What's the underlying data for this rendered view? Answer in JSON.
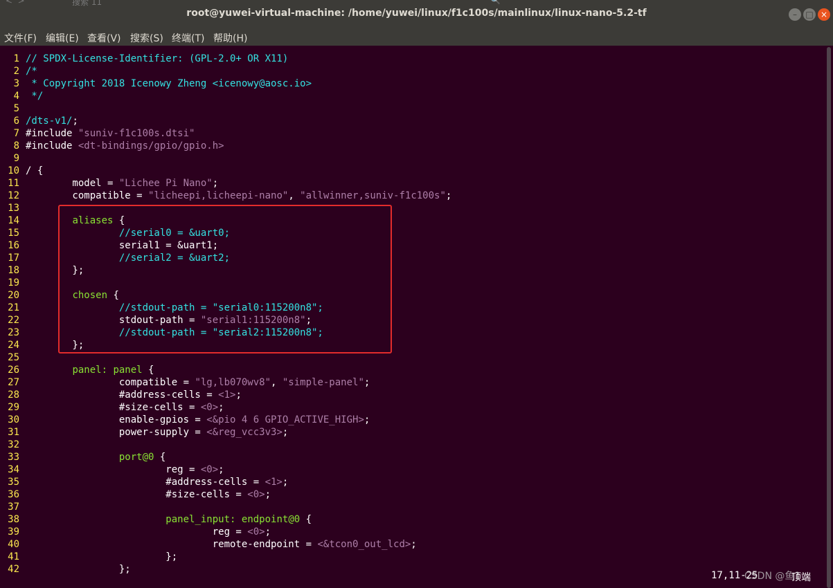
{
  "window": {
    "title": "root@yuwei-virtual-machine: /home/yuwei/linux/f1c100s/mainlinux/linux-nano-5.2-tf",
    "ghost_tab": "搜索 11",
    "controls": {
      "minimize": "–",
      "maximize": "□",
      "close": "×"
    }
  },
  "menu": [
    "文件(F)",
    "编辑(E)",
    "查看(V)",
    "搜索(S)",
    "终端(T)",
    "帮助(H)"
  ],
  "editor": {
    "lines": [
      {
        "n": "1",
        "segs": [
          {
            "t": "// SPDX-License-Identifier: (GPL-2.0+ OR X11)",
            "c": "comment"
          }
        ]
      },
      {
        "n": "2",
        "segs": [
          {
            "t": "/*",
            "c": "comment"
          }
        ]
      },
      {
        "n": "3",
        "segs": [
          {
            "t": " * Copyright 2018 Icenowy Zheng <icenowy@aosc.io>",
            "c": "comment"
          }
        ]
      },
      {
        "n": "4",
        "segs": [
          {
            "t": " */",
            "c": "comment"
          }
        ]
      },
      {
        "n": "5",
        "segs": []
      },
      {
        "n": "6",
        "segs": [
          {
            "t": "/dts-v1/",
            "c": "keyword"
          },
          {
            "t": ";",
            "c": "pp"
          }
        ]
      },
      {
        "n": "7",
        "segs": [
          {
            "t": "#include ",
            "c": "pp"
          },
          {
            "t": "\"suniv-f1c100s.dtsi\"",
            "c": "string"
          }
        ]
      },
      {
        "n": "8",
        "segs": [
          {
            "t": "#include ",
            "c": "pp"
          },
          {
            "t": "<dt-bindings/gpio/gpio.h>",
            "c": "string"
          }
        ]
      },
      {
        "n": "9",
        "segs": []
      },
      {
        "n": "10",
        "segs": [
          {
            "t": "/ {",
            "c": "pp"
          }
        ]
      },
      {
        "n": "11",
        "segs": [
          {
            "t": "        model = ",
            "c": "pp"
          },
          {
            "t": "\"Lichee Pi Nano\"",
            "c": "string"
          },
          {
            "t": ";",
            "c": "pp"
          }
        ]
      },
      {
        "n": "12",
        "segs": [
          {
            "t": "        compatible = ",
            "c": "pp"
          },
          {
            "t": "\"licheepi,licheepi-nano\"",
            "c": "string"
          },
          {
            "t": ", ",
            "c": "pp"
          },
          {
            "t": "\"allwinner,suniv-f1c100s\"",
            "c": "string"
          },
          {
            "t": ";",
            "c": "pp"
          }
        ]
      },
      {
        "n": "13",
        "segs": []
      },
      {
        "n": "14",
        "segs": [
          {
            "t": "        ",
            "c": "pp"
          },
          {
            "t": "aliases",
            "c": "label"
          },
          {
            "t": " {",
            "c": "pp"
          }
        ]
      },
      {
        "n": "15",
        "segs": [
          {
            "t": "                ",
            "c": "pp"
          },
          {
            "t": "//serial0 = &uart0;",
            "c": "comment"
          }
        ]
      },
      {
        "n": "16",
        "segs": [
          {
            "t": "                serial1 = &uart1;",
            "c": "pp"
          }
        ]
      },
      {
        "n": "17",
        "segs": [
          {
            "t": "                ",
            "c": "pp"
          },
          {
            "t": "//serial2 = &uart2;",
            "c": "comment"
          }
        ]
      },
      {
        "n": "18",
        "segs": [
          {
            "t": "        };",
            "c": "pp"
          }
        ]
      },
      {
        "n": "19",
        "segs": []
      },
      {
        "n": "20",
        "segs": [
          {
            "t": "        ",
            "c": "pp"
          },
          {
            "t": "chosen",
            "c": "label"
          },
          {
            "t": " {",
            "c": "pp"
          }
        ]
      },
      {
        "n": "21",
        "segs": [
          {
            "t": "                ",
            "c": "pp"
          },
          {
            "t": "//stdout-path = \"serial0:115200n8\";",
            "c": "comment"
          }
        ]
      },
      {
        "n": "22",
        "segs": [
          {
            "t": "                stdout-path = ",
            "c": "pp"
          },
          {
            "t": "\"serial1:115200n8\"",
            "c": "string"
          },
          {
            "t": ";",
            "c": "pp"
          }
        ]
      },
      {
        "n": "23",
        "segs": [
          {
            "t": "                ",
            "c": "pp"
          },
          {
            "t": "//stdout-path = \"serial2:115200n8\";",
            "c": "comment"
          }
        ]
      },
      {
        "n": "24",
        "segs": [
          {
            "t": "        };",
            "c": "pp"
          }
        ]
      },
      {
        "n": "25",
        "segs": []
      },
      {
        "n": "26",
        "segs": [
          {
            "t": "        ",
            "c": "pp"
          },
          {
            "t": "panel:",
            "c": "label"
          },
          {
            "t": " ",
            "c": "pp"
          },
          {
            "t": "panel",
            "c": "label"
          },
          {
            "t": " {",
            "c": "pp"
          }
        ]
      },
      {
        "n": "27",
        "segs": [
          {
            "t": "                compatible = ",
            "c": "pp"
          },
          {
            "t": "\"lg,lb070wv8\"",
            "c": "string"
          },
          {
            "t": ", ",
            "c": "pp"
          },
          {
            "t": "\"simple-panel\"",
            "c": "string"
          },
          {
            "t": ";",
            "c": "pp"
          }
        ]
      },
      {
        "n": "28",
        "segs": [
          {
            "t": "                #address-cells = ",
            "c": "pp"
          },
          {
            "t": "<1>",
            "c": "string"
          },
          {
            "t": ";",
            "c": "pp"
          }
        ]
      },
      {
        "n": "29",
        "segs": [
          {
            "t": "                #size-cells = ",
            "c": "pp"
          },
          {
            "t": "<0>",
            "c": "string"
          },
          {
            "t": ";",
            "c": "pp"
          }
        ]
      },
      {
        "n": "30",
        "segs": [
          {
            "t": "                enable-gpios = ",
            "c": "pp"
          },
          {
            "t": "<&pio 4 6 GPIO_ACTIVE_HIGH>",
            "c": "string"
          },
          {
            "t": ";",
            "c": "pp"
          }
        ]
      },
      {
        "n": "31",
        "segs": [
          {
            "t": "                power-supply = ",
            "c": "pp"
          },
          {
            "t": "<&reg_vcc3v3>",
            "c": "string"
          },
          {
            "t": ";",
            "c": "pp"
          }
        ]
      },
      {
        "n": "32",
        "segs": []
      },
      {
        "n": "33",
        "segs": [
          {
            "t": "                ",
            "c": "pp"
          },
          {
            "t": "port@0",
            "c": "label"
          },
          {
            "t": " {",
            "c": "pp"
          }
        ]
      },
      {
        "n": "34",
        "segs": [
          {
            "t": "                        reg = ",
            "c": "pp"
          },
          {
            "t": "<0>",
            "c": "string"
          },
          {
            "t": ";",
            "c": "pp"
          }
        ]
      },
      {
        "n": "35",
        "segs": [
          {
            "t": "                        #address-cells = ",
            "c": "pp"
          },
          {
            "t": "<1>",
            "c": "string"
          },
          {
            "t": ";",
            "c": "pp"
          }
        ]
      },
      {
        "n": "36",
        "segs": [
          {
            "t": "                        #size-cells = ",
            "c": "pp"
          },
          {
            "t": "<0>",
            "c": "string"
          },
          {
            "t": ";",
            "c": "pp"
          }
        ]
      },
      {
        "n": "37",
        "segs": []
      },
      {
        "n": "38",
        "segs": [
          {
            "t": "                        ",
            "c": "pp"
          },
          {
            "t": "panel_input:",
            "c": "label"
          },
          {
            "t": " ",
            "c": "pp"
          },
          {
            "t": "endpoint@0",
            "c": "label"
          },
          {
            "t": " {",
            "c": "pp"
          }
        ]
      },
      {
        "n": "39",
        "segs": [
          {
            "t": "                                reg = ",
            "c": "pp"
          },
          {
            "t": "<0>",
            "c": "string"
          },
          {
            "t": ";",
            "c": "pp"
          }
        ]
      },
      {
        "n": "40",
        "segs": [
          {
            "t": "                                remote-endpoint = ",
            "c": "pp"
          },
          {
            "t": "<&tcon0_out_lcd>",
            "c": "string"
          },
          {
            "t": ";",
            "c": "pp"
          }
        ]
      },
      {
        "n": "41",
        "segs": [
          {
            "t": "                        };",
            "c": "pp"
          }
        ]
      },
      {
        "n": "42",
        "segs": [
          {
            "t": "                };",
            "c": "pp"
          }
        ]
      }
    ]
  },
  "status": {
    "position": "17,11-25",
    "scroll_pos": "顶端",
    "watermark": "CSDN @鱼1"
  },
  "colors": {
    "background": "#2c001e",
    "line_numbers": "#fce94f",
    "comment": "#34e2e2",
    "string": "#ad7fa8",
    "label": "#8ae234",
    "highlight_box": "#e32c2c"
  }
}
